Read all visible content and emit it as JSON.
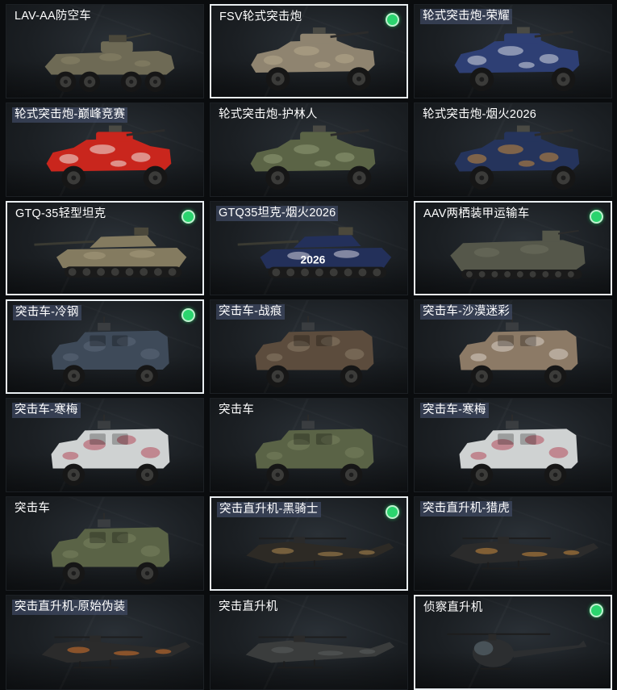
{
  "cards": [
    {
      "label": "LAV-AA防空车",
      "selected": false,
      "highlight": false,
      "badge": false,
      "vehicle": "lav-aa",
      "body": "#6e6a55",
      "camo": "#8a8468"
    },
    {
      "label": "FSV轮式突击炮",
      "selected": true,
      "highlight": false,
      "badge": true,
      "vehicle": "wheeled-gun",
      "body": "#8f8470",
      "camo": "#b6a98c"
    },
    {
      "label": "轮式突击炮-荣耀",
      "selected": false,
      "highlight": true,
      "badge": false,
      "vehicle": "wheeled-gun",
      "body": "#2e3f74",
      "camo": "#d7dbe3"
    },
    {
      "label": "轮式突击炮-巅峰竞赛",
      "selected": false,
      "highlight": true,
      "badge": false,
      "vehicle": "wheeled-gun",
      "body": "#c9261d",
      "camo": "#efe8e2"
    },
    {
      "label": "轮式突击炮-护林人",
      "selected": false,
      "highlight": false,
      "badge": false,
      "vehicle": "wheeled-gun",
      "body": "#5b6446",
      "camo": "#8f9a76"
    },
    {
      "label": "轮式突击炮-烟火2026",
      "selected": false,
      "highlight": false,
      "badge": false,
      "vehicle": "wheeled-gun",
      "body": "#25345c",
      "camo": "#c98a3c"
    },
    {
      "label": "GTQ-35轻型坦克",
      "selected": true,
      "highlight": false,
      "badge": true,
      "vehicle": "tank",
      "body": "#847b60",
      "camo": "#a59b7c"
    },
    {
      "label": "GTQ35坦克-烟火2026",
      "selected": false,
      "highlight": true,
      "badge": false,
      "vehicle": "tank",
      "body": "#23305a",
      "camo": "#d2cfdc",
      "decal": "2026"
    },
    {
      "label": "AAV两栖装甲运输车",
      "selected": true,
      "highlight": false,
      "badge": true,
      "vehicle": "aav",
      "body": "#55574a",
      "camo": "#6e705f"
    },
    {
      "label": "突击车-冷钢",
      "selected": true,
      "highlight": true,
      "badge": true,
      "vehicle": "assault",
      "body": "#3e4a59",
      "camo": "#5b6878"
    },
    {
      "label": "突击车-战痕",
      "selected": false,
      "highlight": true,
      "badge": false,
      "vehicle": "assault",
      "body": "#5c4c3d",
      "camo": "#8b7b68"
    },
    {
      "label": "突击车-沙漠迷彩",
      "selected": false,
      "highlight": true,
      "badge": false,
      "vehicle": "assault",
      "body": "#8c7a66",
      "camo": "#d8d0c6"
    },
    {
      "label": "突击车-寒梅",
      "selected": false,
      "highlight": true,
      "badge": false,
      "vehicle": "assault",
      "body": "#cfd2d2",
      "camo": "#b4485a"
    },
    {
      "label": "突击车",
      "selected": false,
      "highlight": false,
      "badge": false,
      "vehicle": "assault",
      "body": "#5a6346",
      "camo": "#79825f"
    },
    {
      "label": "突击车-寒梅",
      "selected": false,
      "highlight": true,
      "badge": false,
      "vehicle": "assault",
      "body": "#cfd2d2",
      "camo": "#b4485a"
    },
    {
      "label": "突击车",
      "selected": false,
      "highlight": false,
      "badge": false,
      "vehicle": "assault",
      "body": "#5a6346",
      "camo": "#79825f"
    },
    {
      "label": "突击直升机-黑骑士",
      "selected": true,
      "highlight": true,
      "badge": true,
      "vehicle": "heli",
      "body": "#2d2a25",
      "camo": "#b08a52"
    },
    {
      "label": "突击直升机-猎虎",
      "selected": false,
      "highlight": true,
      "badge": false,
      "vehicle": "heli",
      "body": "#2b2b2b",
      "camo": "#c98b3e"
    },
    {
      "label": "突击直升机-原始伪装",
      "selected": false,
      "highlight": true,
      "badge": false,
      "vehicle": "heli",
      "body": "#2b2b2b",
      "camo": "#d9742c"
    },
    {
      "label": "突击直升机",
      "selected": false,
      "highlight": false,
      "badge": false,
      "vehicle": "heli",
      "body": "#3a3c3c",
      "camo": "#5a5d5d"
    },
    {
      "label": "侦察直升机",
      "selected": true,
      "highlight": false,
      "badge": true,
      "vehicle": "scout-heli",
      "body": "#2c2e30",
      "camo": "#4b4e51"
    }
  ]
}
